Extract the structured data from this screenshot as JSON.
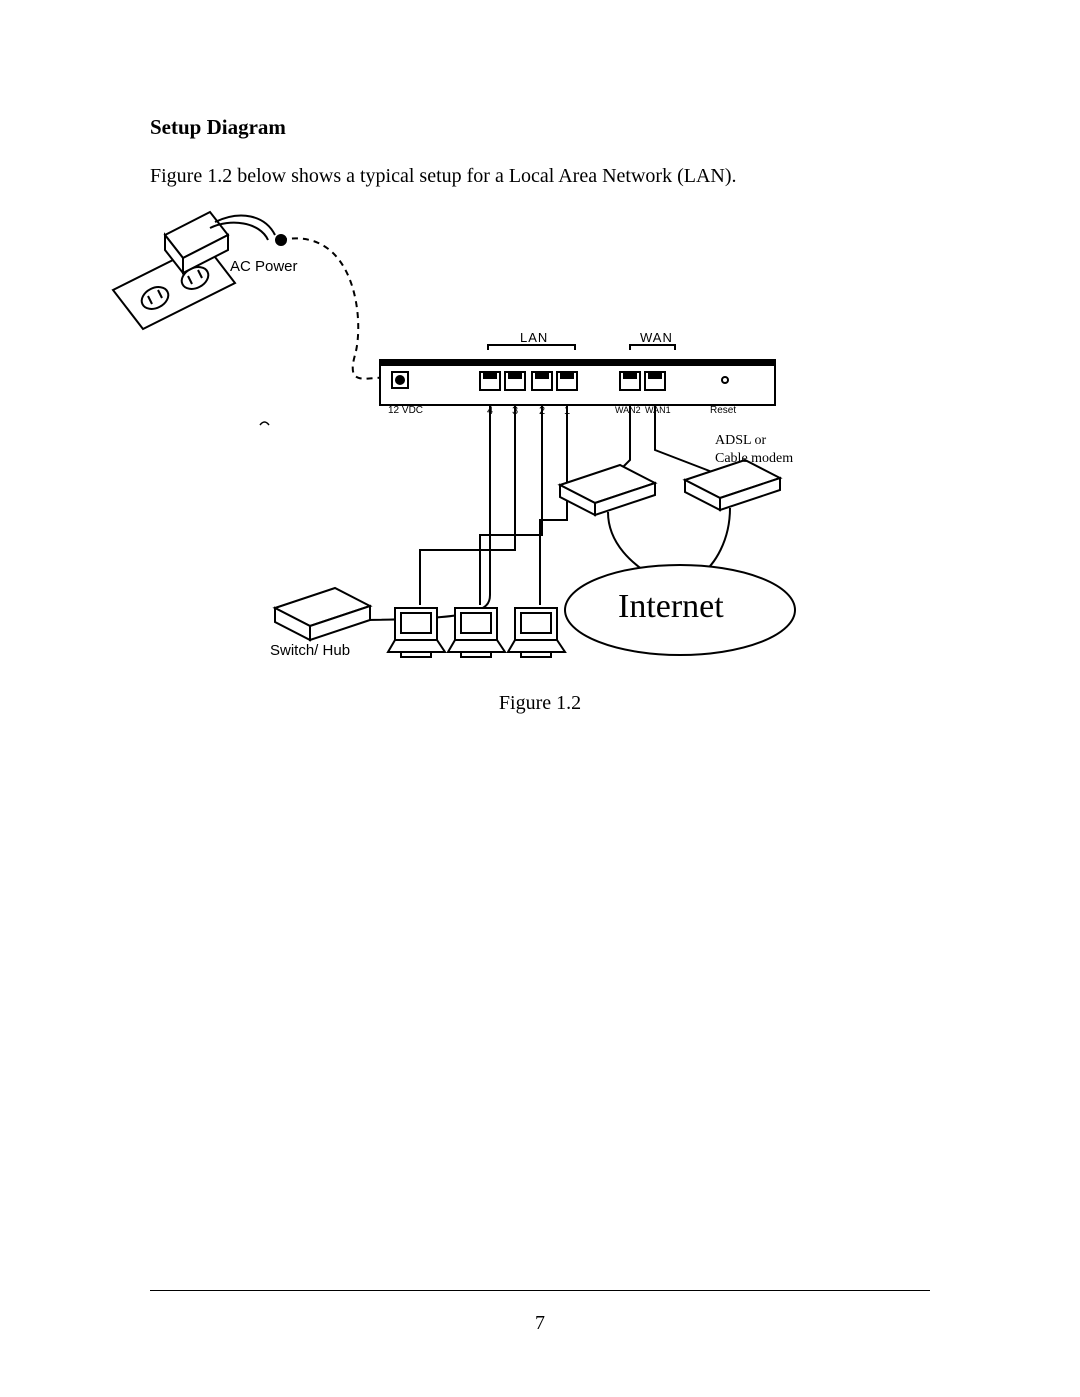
{
  "heading": "Setup Diagram",
  "intro": "Figure 1.2 below shows a typical setup for a Local Area Network (LAN).",
  "caption": "Figure 1.2",
  "page_number": "7",
  "labels": {
    "ac_power": "AC Power",
    "lan": "LAN",
    "wan": "WAN",
    "port_12vdc": "12 VDC",
    "port_4": "4",
    "port_3": "3",
    "port_2": "2",
    "port_1": "1",
    "port_wan2": "WAN2",
    "port_wan1": "WAN1",
    "port_reset": "Reset",
    "modem_note": "ADSL or\nCable modem",
    "internet": "Internet",
    "switch_hub": "Switch/ Hub"
  }
}
